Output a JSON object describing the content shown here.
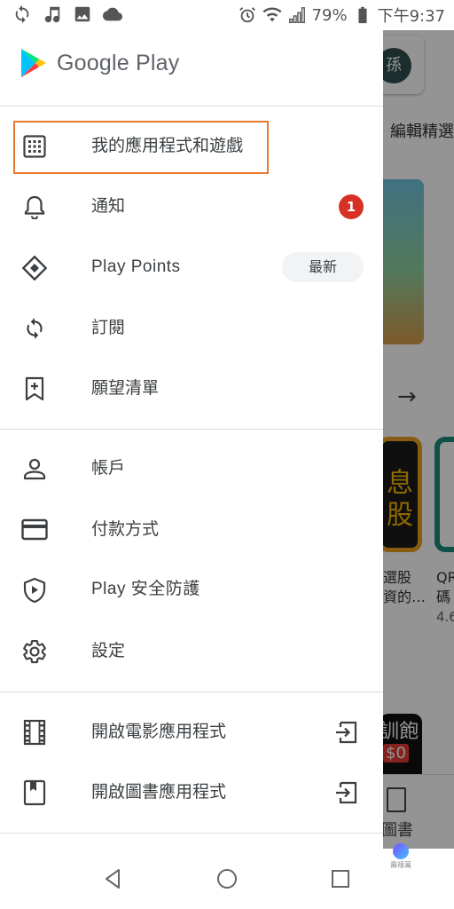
{
  "status_bar": {
    "battery_percent": "79%",
    "time": "下午9:37",
    "left_icons": [
      "sync-icon",
      "music-icon",
      "image-icon",
      "cloud-icon"
    ],
    "right_icons": [
      "alarm-icon",
      "wifi-icon",
      "signal-icon",
      "battery-icon"
    ]
  },
  "drawer": {
    "brand": {
      "name": "Google Play",
      "icon": "google-play-logo"
    },
    "items": [
      {
        "id": "my-apps",
        "label": "我的應用程式和遊戲",
        "icon": "grid-icon",
        "selected": true
      },
      {
        "id": "notifications",
        "label": "通知",
        "icon": "bell-icon",
        "badge": "1"
      },
      {
        "id": "play-points",
        "label": "Play Points",
        "icon": "diamond-icon",
        "chip": "最新"
      },
      {
        "id": "subscriptions",
        "label": "訂閱",
        "icon": "refresh-icon"
      },
      {
        "id": "wishlist",
        "label": "願望清單",
        "icon": "bookmark-add-icon"
      },
      {
        "id": "account",
        "label": "帳戶",
        "icon": "person-icon"
      },
      {
        "id": "payment",
        "label": "付款方式",
        "icon": "credit-card-icon"
      },
      {
        "id": "play-protect",
        "label": "Play 安全防護",
        "icon": "shield-play-icon"
      },
      {
        "id": "settings",
        "label": "設定",
        "icon": "gear-icon"
      },
      {
        "id": "open-movies",
        "label": "開啟電影應用程式",
        "icon": "film-icon",
        "trailing_icon": "exit-to-app-icon"
      },
      {
        "id": "open-books",
        "label": "開啟圖書應用程式",
        "icon": "book-icon",
        "trailing_icon": "exit-to-app-icon"
      }
    ]
  },
  "background": {
    "avatar_letter": "孫",
    "section_title": "編輯精選",
    "tile1_text": "息\n股",
    "tile1_name_line1": "選股",
    "tile1_name_line2": "資的…",
    "tile2_name_line1": "QR",
    "tile2_name_line2": "碼",
    "tile2_rating": "4.6",
    "tile3_text": "訓飽",
    "tile3_price": "$0",
    "bottom_nav_label": "圖書"
  },
  "navbar": {
    "buttons": [
      "back-icon",
      "home-icon",
      "recents-icon"
    ]
  },
  "watermark": {
    "text": "壽祿萬"
  }
}
